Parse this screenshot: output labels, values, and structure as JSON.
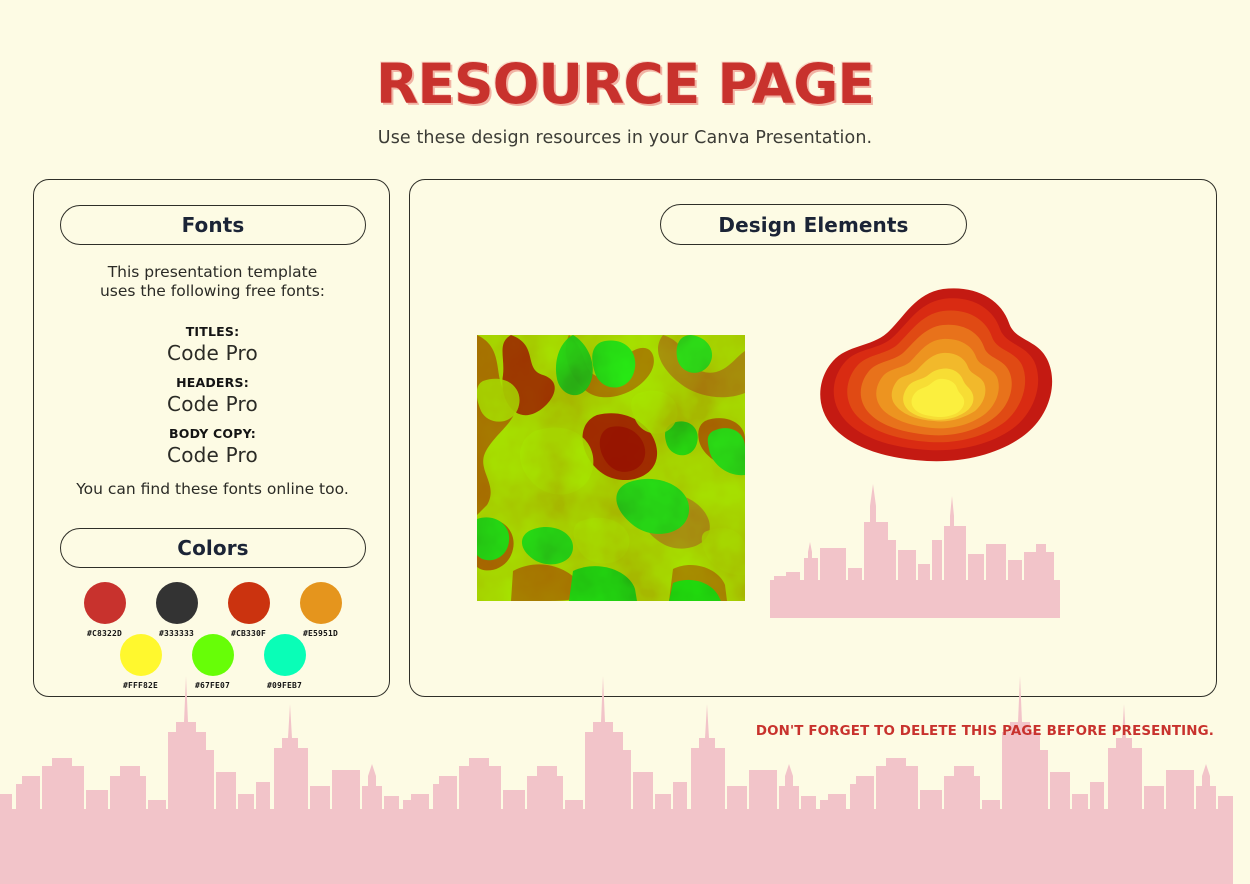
{
  "header": {
    "title": "RESOURCE PAGE",
    "subtitle": "Use these design resources in your Canva Presentation.",
    "title_color": "#C8322D",
    "background_color": "#FDFBE4"
  },
  "fonts_panel": {
    "pill_label": "Fonts",
    "intro_line1": "This presentation template",
    "intro_line2": "uses the following free fonts:",
    "groups": [
      {
        "role": "TITLES:",
        "font": "Code Pro"
      },
      {
        "role": "HEADERS:",
        "font": "Code Pro"
      },
      {
        "role": "BODY COPY:",
        "font": "Code Pro"
      }
    ],
    "footnote": "You can find these fonts online too."
  },
  "colors_panel": {
    "pill_label": "Colors",
    "rows": [
      [
        {
          "hex": "#C8322D"
        },
        {
          "hex": "#333333"
        },
        {
          "hex": "#CB330F"
        },
        {
          "hex": "#E5951D"
        }
      ],
      [
        {
          "hex": "#FFF82E"
        },
        {
          "hex": "#67FE07"
        },
        {
          "hex": "#09FEB7"
        }
      ]
    ]
  },
  "design_panel": {
    "pill_label": "Design Elements",
    "elements": [
      {
        "name": "heatmap-square",
        "kind": "noise-heatmap"
      },
      {
        "name": "contour-blob",
        "kind": "layered-blob"
      },
      {
        "name": "city-skyline",
        "kind": "silhouette"
      }
    ],
    "blob_layers": [
      "#C41A12",
      "#D92B12",
      "#E04A14",
      "#E8721B",
      "#ED9420",
      "#F2B92B",
      "#F7DD34",
      "#FBEF3E"
    ],
    "skyline_color": "#F2C4C9"
  },
  "footer": {
    "warning": "DON'T FORGET TO DELETE THIS PAGE BEFORE PRESENTING.",
    "warning_color": "#C8322D"
  }
}
